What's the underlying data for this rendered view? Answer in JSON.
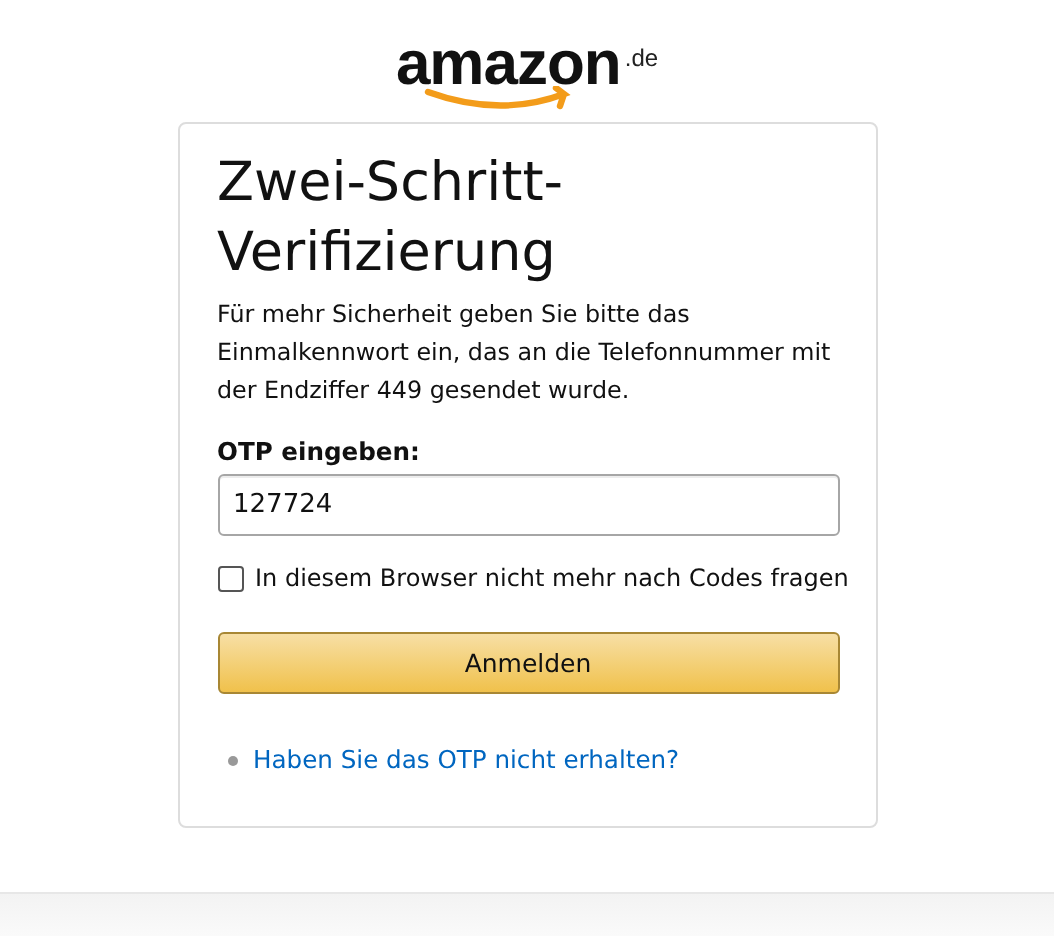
{
  "logo": {
    "wordmark": "amazon",
    "suffix": ".de"
  },
  "card": {
    "title": "Zwei-Schritt-Verifizierung",
    "description": "Für mehr Sicherheit geben Sie bitte das Einmalkennwort ein, das an die Telefonnummer mit der Endziffer 449 gesendet wurde.",
    "otp_field": {
      "label": "OTP eingeben:",
      "value": "127724"
    },
    "remember_checkbox": {
      "label": "In diesem Browser nicht mehr nach Codes fragen",
      "checked": false
    },
    "submit_button": "Anmelden",
    "links": [
      "Haben Sie das OTP nicht erhalten?"
    ]
  }
}
